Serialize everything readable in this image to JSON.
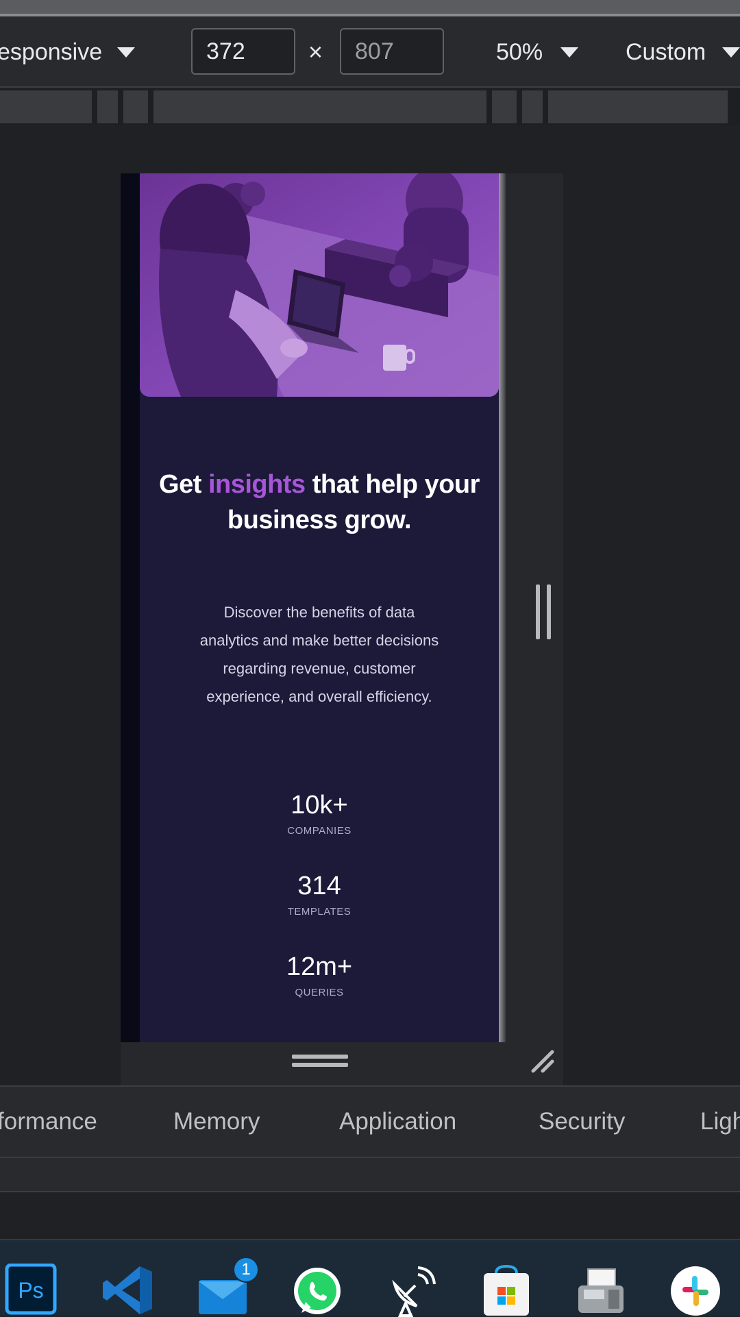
{
  "device_toolbar": {
    "mode_label": "esponsive",
    "width_value": "372",
    "height_value": "807",
    "times_symbol": "×",
    "zoom_label": "50%",
    "throttle_label": "Custom"
  },
  "page": {
    "headline_before": "Get ",
    "headline_accent": "insights",
    "headline_after": " that help your business grow.",
    "description": "Discover the benefits of data analytics and make better decisions regarding revenue, customer experience, and overall efficiency.",
    "stats": [
      {
        "value": "10k+",
        "label": "COMPANIES"
      },
      {
        "value": "314",
        "label": "TEMPLATES"
      },
      {
        "value": "12m+",
        "label": "QUERIES"
      }
    ]
  },
  "devtools": {
    "tabs": [
      "formance",
      "Memory",
      "Application",
      "Security",
      "Ligh"
    ]
  },
  "taskbar": {
    "apps": [
      "photoshop-icon",
      "vscode-icon",
      "mail-icon",
      "whatsapp-icon",
      "satellite-icon",
      "microsoft-store-icon",
      "fax-icon",
      "slack-icon"
    ],
    "mail_badge": "1",
    "photoshop_label": "Ps"
  },
  "colors": {
    "accent": "#a855d8",
    "page_background": "#1c1939",
    "hero_tint": "#7a3fa8"
  }
}
